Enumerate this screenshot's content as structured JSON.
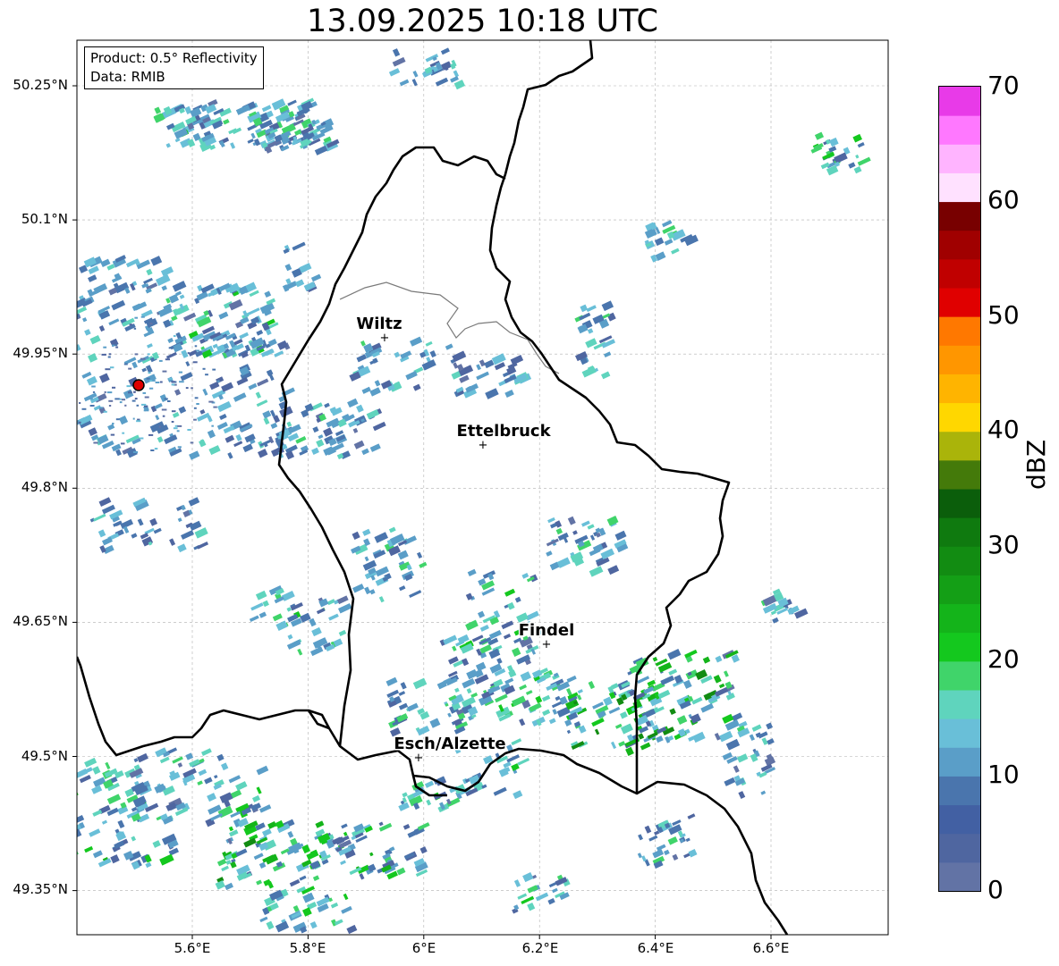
{
  "title": "13.09.2025 10:18 UTC",
  "info": {
    "product": "Product: 0.5° Reflectivity",
    "data": "Data: RMIB"
  },
  "axes": {
    "lat_labels": [
      "50.25°N",
      "50.1°N",
      "49.95°N",
      "49.8°N",
      "49.65°N",
      "49.5°N",
      "49.35°N"
    ],
    "lon_labels": [
      "5.6°E",
      "5.8°E",
      "6°E",
      "6.2°E",
      "6.4°E",
      "6.6°E"
    ],
    "lon_range": [
      5.4,
      6.8
    ],
    "lat_range": [
      49.3,
      50.3
    ],
    "grid": true
  },
  "cities": [
    {
      "name": "Wiltz",
      "lon": 5.93,
      "lat": 49.967
    },
    {
      "name": "Ettelbruck",
      "lon": 6.1,
      "lat": 49.847
    },
    {
      "name": "Findel",
      "lon": 6.21,
      "lat": 49.626
    },
    {
      "name": "Esch/Alzette",
      "lon": 5.99,
      "lat": 49.499
    }
  ],
  "radar_site": {
    "lon": 5.505,
    "lat": 49.915,
    "color": "#e00000"
  },
  "colorbar": {
    "label": "dBZ",
    "min": 0,
    "max": 70,
    "ticks": [
      "0",
      "10",
      "20",
      "30",
      "40",
      "50",
      "60",
      "70"
    ],
    "colors": [
      "#6273a5",
      "#4f66a0",
      "#4260a3",
      "#4a75ad",
      "#5a9ec8",
      "#69bfd8",
      "#5fd4bd",
      "#40d46a",
      "#14c81e",
      "#14b41a",
      "#149f16",
      "#128c12",
      "#0f7a0f",
      "#0b5e0b",
      "#447a0a",
      "#aab40a",
      "#ffd700",
      "#ffb400",
      "#ff9600",
      "#ff7800",
      "#e00000",
      "#c00000",
      "#a00000",
      "#780000",
      "#ffe1ff",
      "#ffb4ff",
      "#ff78ff",
      "#e83ae8"
    ]
  }
}
